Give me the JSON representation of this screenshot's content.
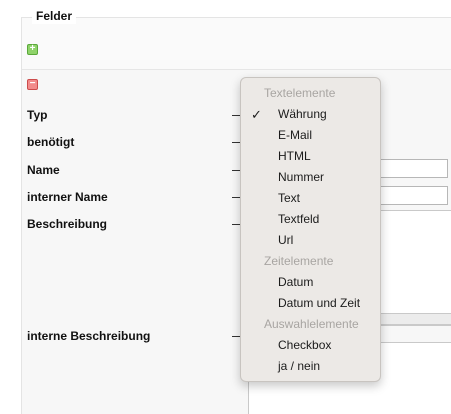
{
  "fieldset": {
    "legend": "Felder"
  },
  "buttons": {
    "add_glyph": "+",
    "remove_glyph": "−"
  },
  "fields": {
    "type_label": "Typ",
    "required_label": "benötigt",
    "name_label": "Name",
    "internal_name_label": "interner Name",
    "description_label": "Beschreibung",
    "internal_description_label": "interne Beschreibung"
  },
  "menu": {
    "headers": [
      "Textelemente",
      "Zeitelemente",
      "Auswahlelemente"
    ],
    "text_items": [
      "Währung",
      "E-Mail",
      "HTML",
      "Nummer",
      "Text",
      "Textfeld",
      "Url"
    ],
    "time_items": [
      "Datum",
      "Datum und Zeit"
    ],
    "choice_items": [
      "Checkbox",
      "ja / nein"
    ],
    "selected": "Währung",
    "check_glyph": "✓"
  },
  "colors": {
    "add": "#8fd36a",
    "remove": "#f28b8b",
    "menu_bg": "#ece9e6",
    "menu_header": "#a8a5a2"
  }
}
